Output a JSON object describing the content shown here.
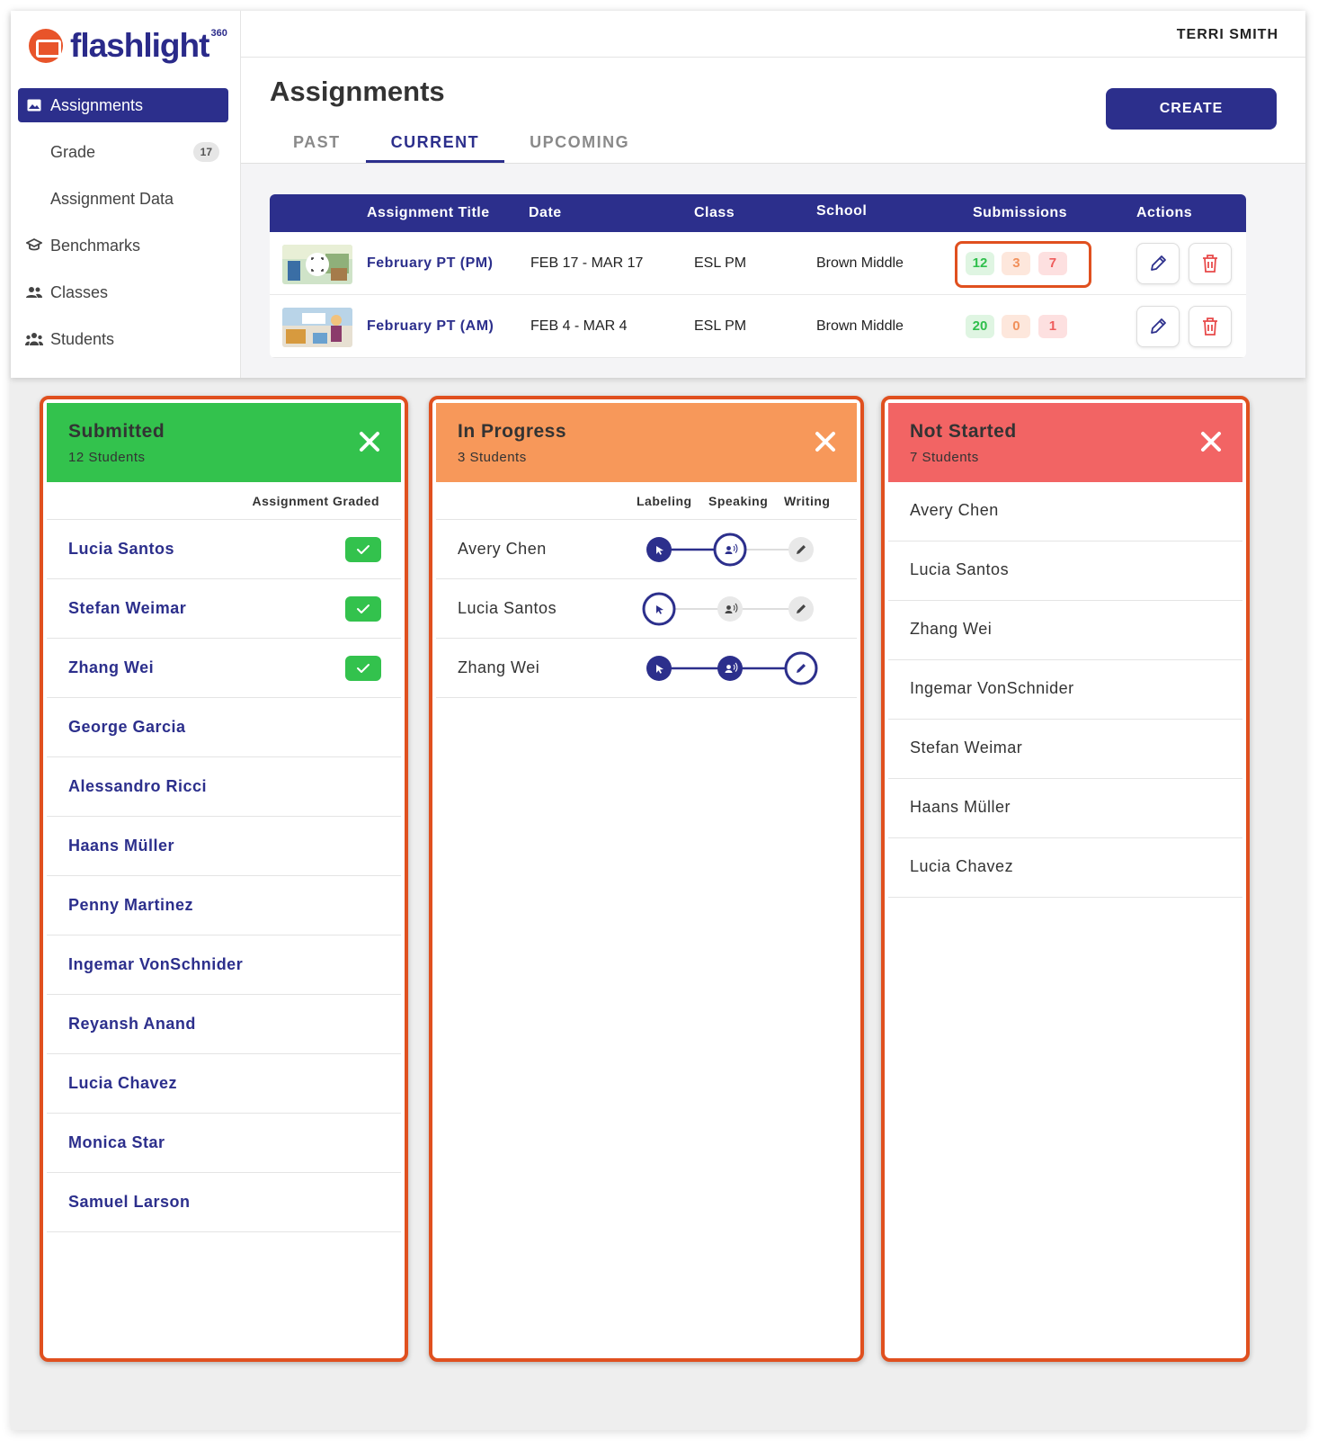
{
  "app": {
    "logo_text": "flashlight",
    "logo_sup": "360",
    "user_name": "TERRI SMITH",
    "brand_color": "#2c2f8c",
    "accent_color": "#e0501f"
  },
  "sidebar": {
    "items": [
      {
        "label": "Assignments",
        "icon": "image-icon",
        "active": true
      },
      {
        "label": "Grade",
        "badge": "17"
      },
      {
        "label": "Assignment Data"
      },
      {
        "label": "Benchmarks",
        "icon": "graduation-cap-icon"
      },
      {
        "label": "Classes",
        "icon": "people-icon"
      },
      {
        "label": "Students",
        "icon": "group-icon"
      }
    ]
  },
  "page": {
    "title": "Assignments",
    "create_label": "CREATE",
    "tabs": [
      {
        "label": "PAST"
      },
      {
        "label": "CURRENT",
        "active": true
      },
      {
        "label": "UPCOMING"
      }
    ]
  },
  "table": {
    "headers": [
      "Assignment Title",
      "Date",
      "Class",
      "School",
      "Submissions",
      "Actions"
    ],
    "rows": [
      {
        "title": "February PT (PM)",
        "date": "FEB 17 - MAR 17",
        "class": "ESL PM",
        "school": "Brown Middle",
        "submitted": "12",
        "in_progress": "3",
        "not_started": "7"
      },
      {
        "title": "February PT (AM)",
        "date": "FEB 4 - MAR 4",
        "class": "ESL PM",
        "school": "Brown Middle",
        "submitted": "20",
        "in_progress": "0",
        "not_started": "1"
      }
    ]
  },
  "panels": {
    "submitted": {
      "title": "Submitted",
      "subtitle": "12 Students",
      "color": "#33c24d",
      "column_header": "Assignment Graded",
      "students": [
        {
          "name": "Lucia Santos",
          "graded": true
        },
        {
          "name": "Stefan Weimar",
          "graded": true
        },
        {
          "name": "Zhang Wei",
          "graded": true
        },
        {
          "name": "George Garcia",
          "graded": false
        },
        {
          "name": "Alessandro Ricci",
          "graded": false
        },
        {
          "name": "Haans Müller",
          "graded": false
        },
        {
          "name": "Penny Martinez",
          "graded": false
        },
        {
          "name": "Ingemar VonSchnider",
          "graded": false
        },
        {
          "name": "Reyansh Anand",
          "graded": false
        },
        {
          "name": "Lucia Chavez",
          "graded": false
        },
        {
          "name": "Monica Star",
          "graded": false
        },
        {
          "name": "Samuel Larson",
          "graded": false
        }
      ]
    },
    "in_progress": {
      "title": "In Progress",
      "subtitle": "3 Students",
      "color": "#f7985a",
      "column_headers": [
        "Labeling",
        "Speaking",
        "Writing"
      ],
      "students": [
        {
          "name": "Avery Chen",
          "stage": "speaking",
          "done": 1
        },
        {
          "name": "Lucia Santos",
          "stage": "labeling",
          "done": 0
        },
        {
          "name": "Zhang Wei",
          "stage": "writing",
          "done": 2
        }
      ]
    },
    "not_started": {
      "title": "Not Started",
      "subtitle": "7 Students",
      "color": "#f26464",
      "students": [
        {
          "name": "Avery Chen"
        },
        {
          "name": "Lucia Santos"
        },
        {
          "name": "Zhang Wei"
        },
        {
          "name": "Ingemar VonSchnider"
        },
        {
          "name": "Stefan Weimar"
        },
        {
          "name": "Haans Müller"
        },
        {
          "name": "Lucia Chavez"
        }
      ]
    }
  }
}
